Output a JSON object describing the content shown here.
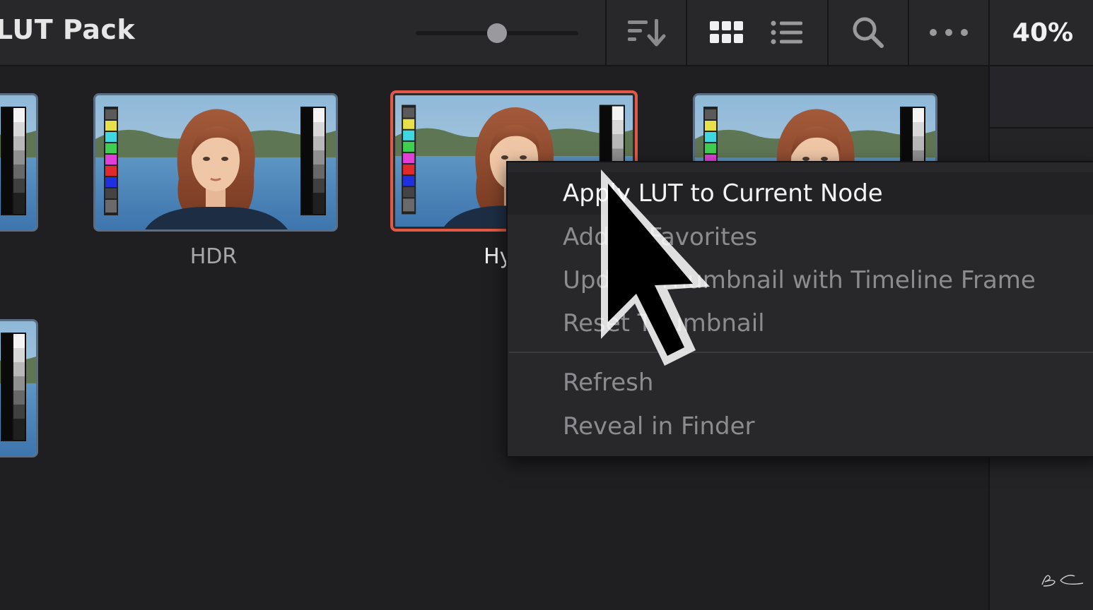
{
  "header": {
    "title": "LUT Pack",
    "zoom_percent": "40%",
    "thumbnail_size_slider": 0.5
  },
  "toolbar": {
    "icons": [
      "sort-icon",
      "grid-view-icon",
      "list-view-icon",
      "search-icon",
      "more-options-icon"
    ]
  },
  "thumbnails": [
    {
      "label": "",
      "selected": false
    },
    {
      "label": "HDR",
      "selected": false
    },
    {
      "label": "Hype",
      "selected": true
    },
    {
      "label": "",
      "selected": false
    },
    {
      "label": "",
      "selected": false
    }
  ],
  "context_menu": {
    "items": [
      {
        "label": "Apply LUT to Current Node",
        "highlighted": true
      },
      {
        "label": "Add to Favorites",
        "highlighted": false
      },
      {
        "label": "Update Thumbnail with Timeline Frame",
        "highlighted": false
      },
      {
        "label": "Reset Thumbnail",
        "highlighted": false
      },
      {
        "label": "Refresh",
        "highlighted": false
      },
      {
        "label": "Reveal in Finder",
        "highlighted": false
      }
    ]
  },
  "colors": {
    "selection_border": "#e25a46",
    "background": "#1f1f22",
    "menu_background": "#28282b"
  }
}
